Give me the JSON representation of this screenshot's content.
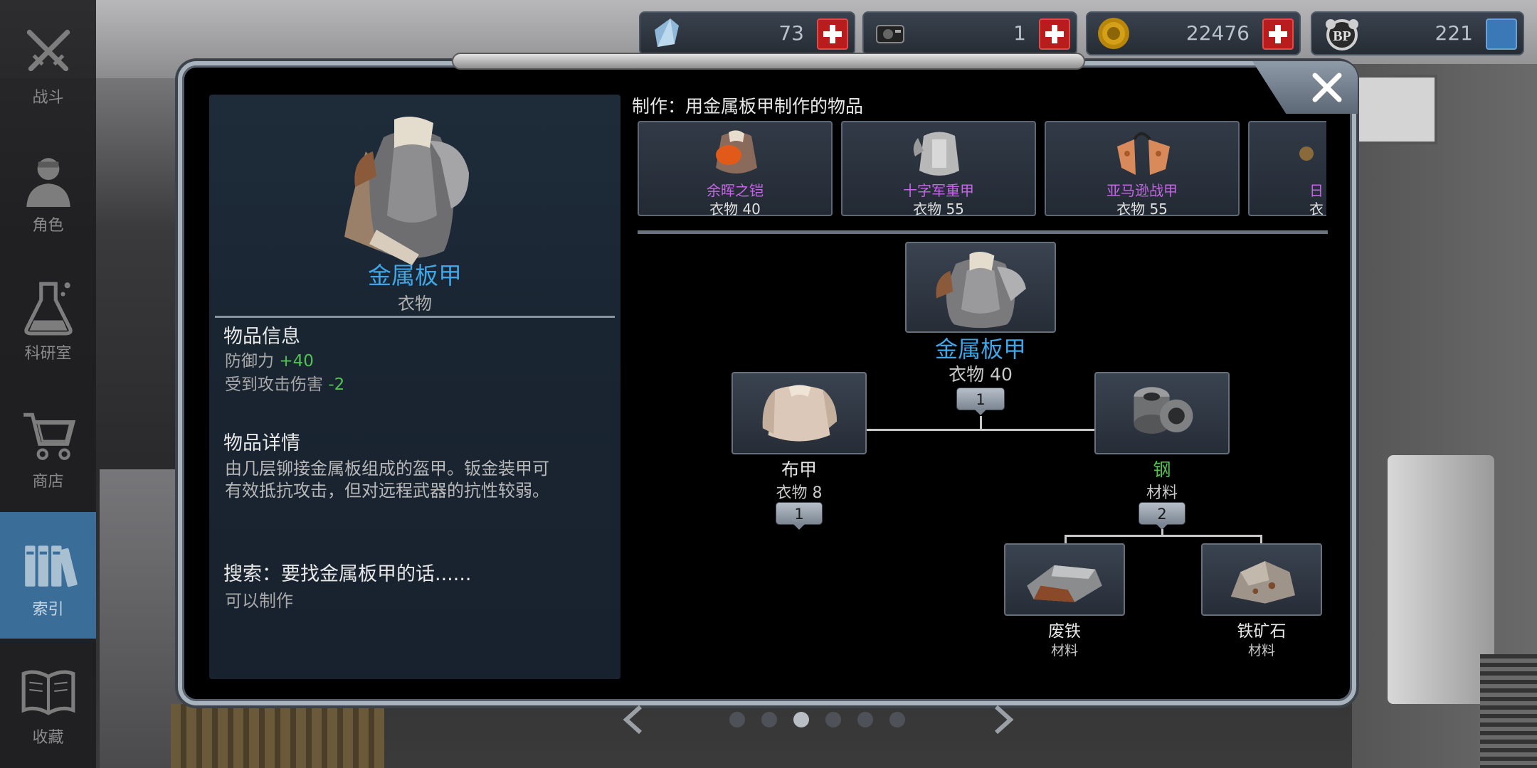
{
  "sidebar": {
    "items": [
      {
        "label": "战斗",
        "icon": "swords-icon",
        "active": false
      },
      {
        "label": "角色",
        "icon": "character-icon",
        "active": false
      },
      {
        "label": "科研室",
        "icon": "flask-icon",
        "active": false
      },
      {
        "label": "商店",
        "icon": "cart-icon",
        "active": false
      },
      {
        "label": "索引",
        "icon": "books-icon",
        "active": true
      },
      {
        "label": "收藏",
        "icon": "open-book-icon",
        "active": false
      }
    ]
  },
  "currencies": [
    {
      "icon": "crystal-icon",
      "value": "73"
    },
    {
      "icon": "device-icon",
      "value": "1"
    },
    {
      "icon": "coin-icon",
      "value": "22476"
    },
    {
      "icon": "bp-badge-icon",
      "value": "221"
    }
  ],
  "detail": {
    "name": "金属板甲",
    "category": "衣物",
    "info_heading": "物品信息",
    "stats": [
      {
        "label": "防御力",
        "value": "+40"
      },
      {
        "label": "受到攻击伤害",
        "value": "-2"
      }
    ],
    "desc_heading": "物品详情",
    "description_line1": "由几层铆接金属板组成的盔甲。钣金装甲可",
    "description_line2": "有效抵抗攻击，但对远程武器的抗性较弱。",
    "search_heading": "搜索：要找金属板甲的话......",
    "search_text": "可以制作"
  },
  "craft": {
    "title": "制作：用金属板甲制作的物品",
    "items": [
      {
        "name": "余晖之铠",
        "value": "衣物 40"
      },
      {
        "name": "十字军重甲",
        "value": "衣物 55"
      },
      {
        "name": "亚马逊战甲",
        "value": "衣物 55"
      },
      {
        "name": "日",
        "value": "衣"
      }
    ]
  },
  "recipe": {
    "root": {
      "name": "金属板甲",
      "value": "衣物 40",
      "qty": "1"
    },
    "left": {
      "name": "布甲",
      "value": "衣物 8",
      "qty": "1"
    },
    "right": {
      "name": "钢",
      "value": "材料",
      "qty": "2"
    },
    "sub1": {
      "name": "废铁",
      "value": "材料"
    },
    "sub2": {
      "name": "铁矿石",
      "value": "材料"
    }
  },
  "pager": {
    "current": 3,
    "total": 6
  },
  "colors": {
    "accent_blue": "#3fa7e8",
    "rare_purple": "#c567e6",
    "green": "#4fc24f",
    "plus_red": "#b81c1c"
  }
}
